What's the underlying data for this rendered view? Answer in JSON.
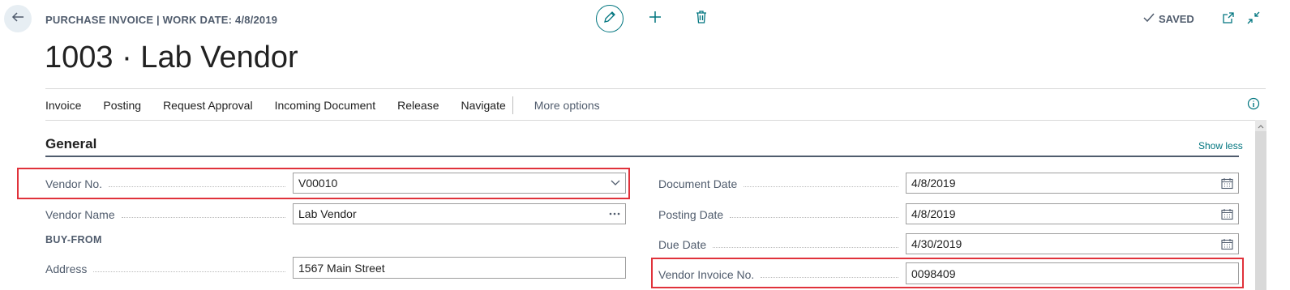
{
  "header": {
    "caption": "PURCHASE INVOICE | WORK DATE: 4/8/2019",
    "title": "1003 · Lab Vendor",
    "saved_label": "SAVED",
    "icons": [
      "back-arrow-icon",
      "edit-pencil-icon",
      "plus-icon",
      "trash-icon",
      "check-icon",
      "open-new-window-icon",
      "collapse-icon"
    ]
  },
  "actions": {
    "items": [
      "Invoice",
      "Posting",
      "Request Approval",
      "Incoming Document",
      "Release",
      "Navigate"
    ],
    "more": "More options",
    "info_icon": "info-icon"
  },
  "general": {
    "title": "General",
    "show_less": "Show less",
    "left": {
      "vendor_no": {
        "label": "Vendor No.",
        "value": "V00010",
        "control": "chevron-down-icon"
      },
      "vendor_name": {
        "label": "Vendor Name",
        "value": "Lab Vendor",
        "control": "ellipsis-icon"
      },
      "buy_from_heading": "BUY-FROM",
      "address": {
        "label": "Address",
        "value": "1567 Main Street"
      }
    },
    "right": {
      "document_date": {
        "label": "Document Date",
        "value": "4/8/2019",
        "control": "calendar-icon"
      },
      "posting_date": {
        "label": "Posting Date",
        "value": "4/8/2019",
        "control": "calendar-icon"
      },
      "due_date": {
        "label": "Due Date",
        "value": "4/30/2019",
        "control": "calendar-icon"
      },
      "vendor_invoice_no": {
        "label": "Vendor Invoice No.",
        "value": "0098409"
      }
    }
  },
  "colors": {
    "accent": "#00757f",
    "highlight": "#e0323b",
    "label": "#505c6d"
  }
}
